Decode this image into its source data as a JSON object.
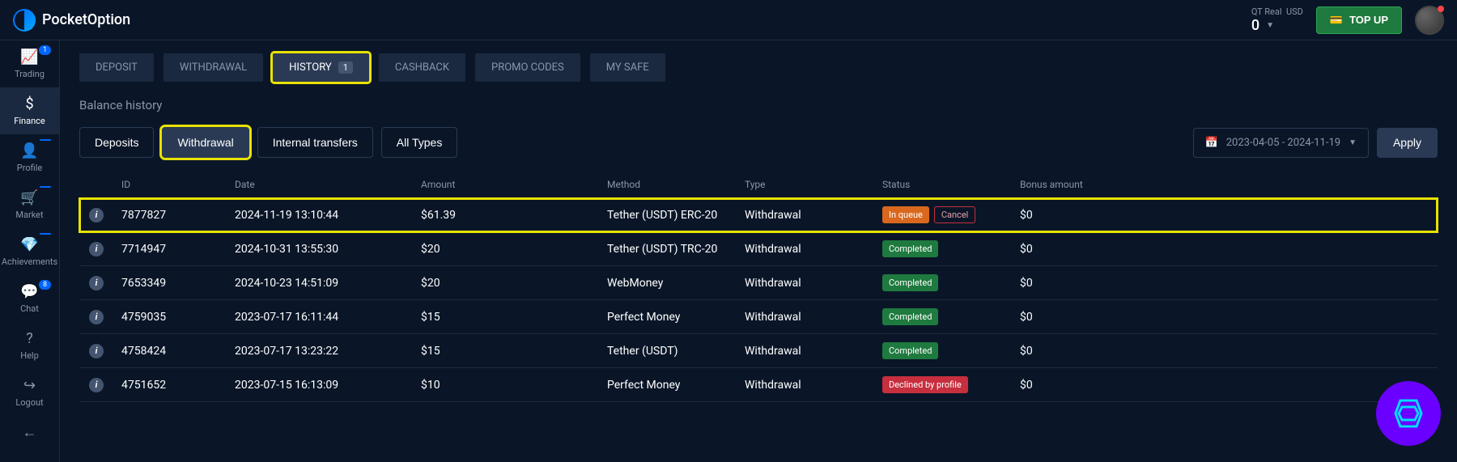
{
  "header": {
    "brand": "PocketOption",
    "account_type": "QT Real",
    "currency": "USD",
    "balance": "0",
    "topup": "TOP UP"
  },
  "sidebar": [
    {
      "icon": "📈",
      "label": "Trading",
      "badge": "1"
    },
    {
      "icon": "$",
      "label": "Finance",
      "active": true
    },
    {
      "icon": "👤",
      "label": "Profile",
      "badge": " "
    },
    {
      "icon": "🛒",
      "label": "Market",
      "badge": " "
    },
    {
      "icon": "💎",
      "label": "Achievements",
      "badge": " "
    },
    {
      "icon": "💬",
      "label": "Chat",
      "badge": "8"
    },
    {
      "icon": "?",
      "label": "Help"
    },
    {
      "icon": "↪",
      "label": "Logout"
    },
    {
      "icon": "←",
      "label": ""
    }
  ],
  "tabs": [
    {
      "label": "DEPOSIT"
    },
    {
      "label": "WITHDRAWAL"
    },
    {
      "label": "HISTORY",
      "badge": "1",
      "active": true
    },
    {
      "label": "CASHBACK"
    },
    {
      "label": "PROMO CODES"
    },
    {
      "label": "MY SAFE"
    }
  ],
  "section_title": "Balance history",
  "filters": [
    {
      "label": "Deposits"
    },
    {
      "label": "Withdrawal",
      "active": true
    },
    {
      "label": "Internal transfers"
    },
    {
      "label": "All Types"
    }
  ],
  "date_range": "2023-04-05 - 2024-11-19",
  "apply_label": "Apply",
  "columns": [
    "",
    "ID",
    "Date",
    "Amount",
    "Method",
    "Type",
    "Status",
    "Bonus amount"
  ],
  "rows": [
    {
      "id": "7877827",
      "date": "2024-11-19 13:10:44",
      "amount": "$61.39",
      "method": "Tether (USDT) ERC-20",
      "type": "Withdrawal",
      "status": "In queue",
      "status_class": "queue",
      "cancel": "Cancel",
      "bonus": "$0",
      "highlighted": true
    },
    {
      "id": "7714947",
      "date": "2024-10-31 13:55:30",
      "amount": "$20",
      "method": "Tether (USDT) TRC-20",
      "type": "Withdrawal",
      "status": "Completed",
      "status_class": "completed",
      "bonus": "$0"
    },
    {
      "id": "7653349",
      "date": "2024-10-23 14:51:09",
      "amount": "$20",
      "method": "WebMoney",
      "type": "Withdrawal",
      "status": "Completed",
      "status_class": "completed",
      "bonus": "$0"
    },
    {
      "id": "4759035",
      "date": "2023-07-17 16:11:44",
      "amount": "$15",
      "method": "Perfect Money",
      "type": "Withdrawal",
      "status": "Completed",
      "status_class": "completed",
      "bonus": "$0"
    },
    {
      "id": "4758424",
      "date": "2023-07-17 13:23:22",
      "amount": "$15",
      "method": "Tether (USDT)",
      "type": "Withdrawal",
      "status": "Completed",
      "status_class": "completed",
      "bonus": "$0"
    },
    {
      "id": "4751652",
      "date": "2023-07-15 16:13:09",
      "amount": "$10",
      "method": "Perfect Money",
      "type": "Withdrawal",
      "status": "Declined by profile",
      "status_class": "declined",
      "bonus": "$0"
    }
  ]
}
